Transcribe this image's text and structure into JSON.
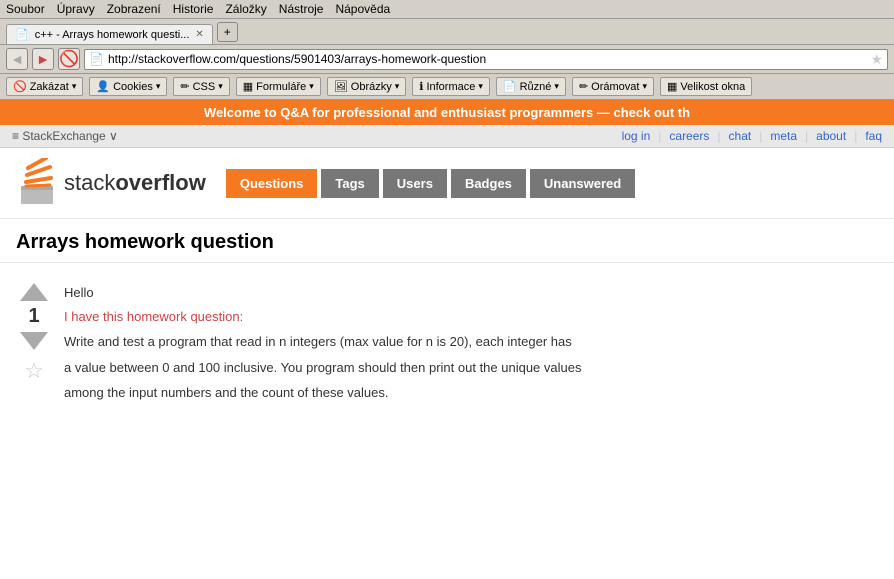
{
  "browser": {
    "menu": [
      "Soubor",
      "Úpravy",
      "Zobrazení",
      "Historie",
      "Záložky",
      "Nástroje",
      "Nápověda"
    ],
    "tab_title": "c++ - Arrays homework questi...",
    "tab_add_label": "+",
    "nav_back": "◄",
    "nav_forward": "►",
    "nav_stop": "🚫",
    "address": "http://stackoverflow.com/questions/5901403/arrays-homework-question",
    "star": "★"
  },
  "toolbar": {
    "buttons": [
      {
        "label": "Zakázat",
        "icon": "🚫"
      },
      {
        "label": "Cookies",
        "icon": "👤"
      },
      {
        "label": "CSS",
        "icon": "✏"
      },
      {
        "label": "Formuláře",
        "icon": "▦"
      },
      {
        "label": "Obrázky",
        "icon": "🖼"
      },
      {
        "label": "Informace",
        "icon": "ℹ"
      },
      {
        "label": "Různé",
        "icon": "📄"
      },
      {
        "label": "Orámovat",
        "icon": "✏"
      },
      {
        "label": "Velikost okna",
        "icon": "▦"
      }
    ]
  },
  "banner": {
    "text": "Welcome to Q&A for professional and enthusiast programmers — check out th"
  },
  "se_bar": {
    "left": "≡ StackExchange ∨",
    "links": [
      "log in",
      "careers",
      "chat",
      "meta",
      "about",
      "faq"
    ]
  },
  "so_header": {
    "logo_text_plain": "stack",
    "logo_text_bold": "overflow",
    "nav": [
      {
        "label": "Questions",
        "active": true
      },
      {
        "label": "Tags",
        "active": false
      },
      {
        "label": "Users",
        "active": false
      },
      {
        "label": "Badges",
        "active": false
      },
      {
        "label": "Unanswered",
        "active": false
      }
    ]
  },
  "question": {
    "title": "Arrays homework question",
    "vote_count": "1",
    "body_greeting": "Hello",
    "body_hw": "I have this homework question:",
    "body_line1": "Write and test a program that read in n integers (max value for n is 20), each integer has",
    "body_line2": "a value between 0 and 100 inclusive. You program should then print out the unique values",
    "body_line3": "among the input numbers and the count of these values."
  }
}
